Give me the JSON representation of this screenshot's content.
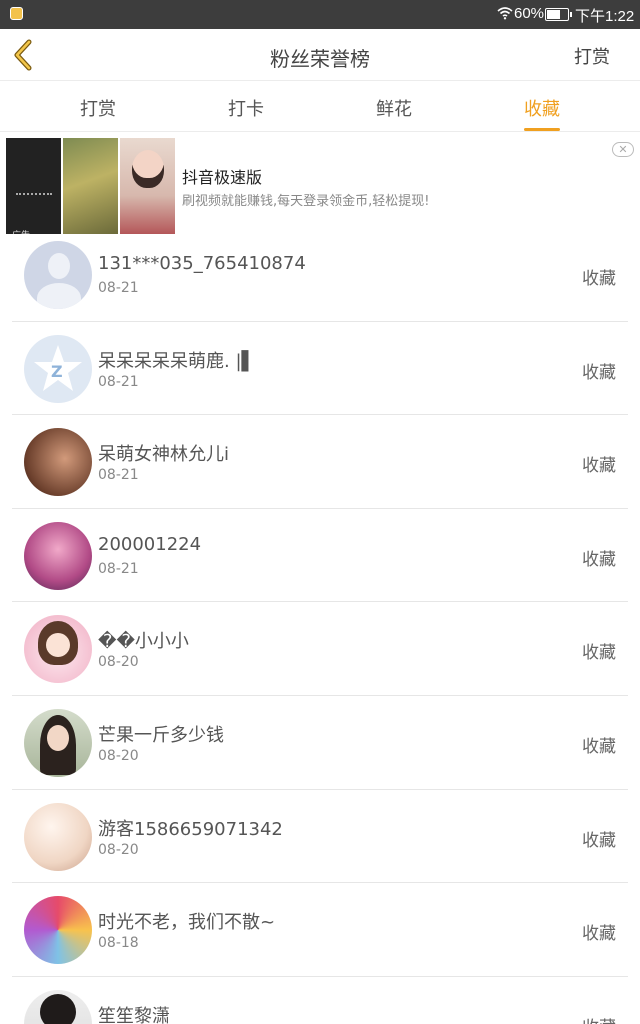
{
  "status_bar": {
    "battery_pct": "60%",
    "time": "下午1:22"
  },
  "header": {
    "title": "粉丝荣誉榜",
    "right_label": "打赏",
    "accent": "#f0a020"
  },
  "tabs": [
    {
      "label": "打赏",
      "active": false
    },
    {
      "label": "打卡",
      "active": false
    },
    {
      "label": "鲜花",
      "active": false
    },
    {
      "label": "收藏",
      "active": true
    }
  ],
  "ad": {
    "title": "抖音极速版",
    "description": "刷视频就能赚钱,每天登录领金币,轻松提现!",
    "tag": "广告",
    "close_icon": "close-icon"
  },
  "list": [
    {
      "name": "131***035_765410874",
      "date": "08-21",
      "action": "收藏"
    },
    {
      "name": "呆呆呆呆呆萌鹿. |▌",
      "date": "08-21",
      "action": "收藏"
    },
    {
      "name": "呆萌女神林允儿i",
      "date": "08-21",
      "action": "收藏"
    },
    {
      "name": "200001224",
      "date": "08-21",
      "action": "收藏"
    },
    {
      "name": "��小小小",
      "date": "08-20",
      "action": "收藏"
    },
    {
      "name": "芒果一斤多少钱",
      "date": "08-20",
      "action": "收藏"
    },
    {
      "name": "游客1586659071342",
      "date": "08-20",
      "action": "收藏"
    },
    {
      "name": "时光不老，我们不散~",
      "date": "08-18",
      "action": "收藏"
    },
    {
      "name": "笙笙黎潇",
      "date": "",
      "action": "收藏"
    }
  ]
}
